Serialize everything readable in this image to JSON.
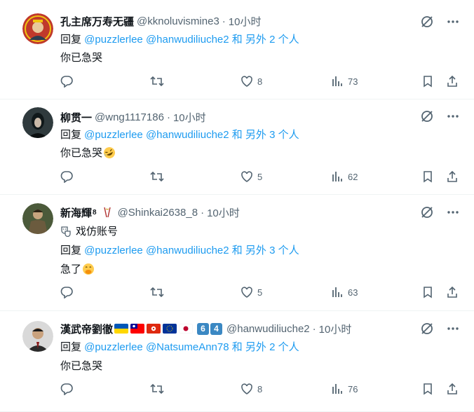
{
  "tweets": [
    {
      "name": "孔主席万寿无疆",
      "handle": "@kknoluvismine3",
      "dot": "·",
      "time": "10小时",
      "reply_prefix": "回复 ",
      "mentions": [
        "@puzzlerlee",
        "@hanwudiliuche2"
      ],
      "reply_suffix": " 和 另外 2 个人",
      "text": "你已急哭",
      "likes": "8",
      "views": "73",
      "avatar_color": "#c0392b"
    },
    {
      "name": "柳贯一",
      "handle": "@wng1117186",
      "dot": "·",
      "time": "10小时",
      "reply_prefix": "回复 ",
      "mentions": [
        "@puzzlerlee",
        "@hanwudiliuche2"
      ],
      "reply_suffix": " 和 另外 3 个人",
      "text": "你已急哭",
      "text_emoji": "rofl-emoji",
      "likes": "5",
      "views": "62",
      "avatar_color": "#2f3a3d"
    },
    {
      "name": "新海輝",
      "name_sup": "8",
      "name_icon": "chopsticks-icon",
      "handle": "@Shinkai2638_8",
      "dot": "·",
      "time": "10小时",
      "parody_icon": "theater-masks-icon",
      "parody_label": "戏仿账号",
      "reply_prefix": "回复 ",
      "mentions": [
        "@puzzlerlee",
        "@hanwudiliuche2"
      ],
      "reply_suffix": " 和 另外 3 个人",
      "text": "急了",
      "text_emoji": "face-with-hand-over-mouth-emoji",
      "likes": "5",
      "views": "63",
      "avatar_color": "#4b5a3a"
    },
    {
      "name": "漢武帝劉徹",
      "flags": [
        "ukraine-flag",
        "taiwan-flag",
        "hongkong-flag",
        "eu-flag",
        "japan-flag"
      ],
      "keycaps": [
        "6",
        "4"
      ],
      "handle": "@hanwudiliuche2",
      "dot": "·",
      "time": "10小时",
      "reply_prefix": "回复 ",
      "mentions": [
        "@puzzlerlee",
        "@NatsumeAnn78"
      ],
      "reply_suffix": " 和 另外 2 个人",
      "text": "你已急哭",
      "likes": "8",
      "views": "76",
      "avatar_color": "#3a3a3a"
    }
  ],
  "colors": {
    "link": "#1d9bf0",
    "secondary_text": "#536471",
    "divider": "#eff3f4"
  }
}
